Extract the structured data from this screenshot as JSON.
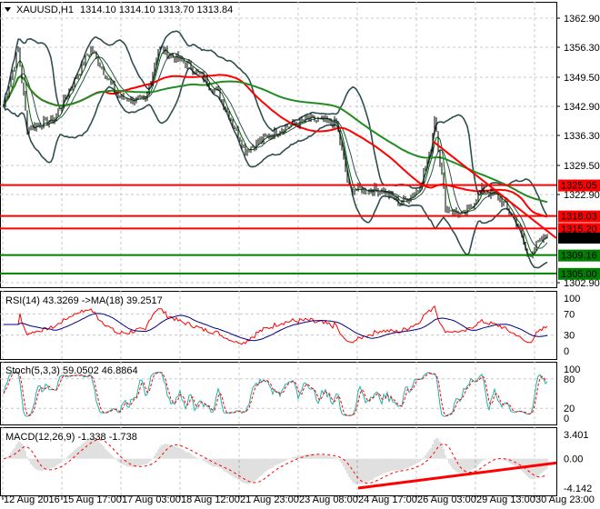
{
  "header": {
    "symbol": "XAUUSD,H1",
    "ohlc": "1314.10 1314.10 1313.70 1313.84"
  },
  "colors": {
    "up": "#000000",
    "line": "#2f4f4f",
    "ma_fast": "#006400",
    "ma_slow": "#006400",
    "ma_mid": "#ff0000",
    "level_red": "#ff0000",
    "level_green": "#008000",
    "rsi": "#ff0000",
    "rsi_ma": "#000080",
    "stoch_main": "#20b2aa",
    "stoch_sig": "#ff0000",
    "macd_hist": "#c0c0c0",
    "macd_sig": "#ff0000"
  },
  "chart_data": [
    {
      "type": "line",
      "title": "XAUUSD,H1",
      "ylim": [
        1302.9,
        1362.9
      ],
      "y_ticks": [
        "1362.90",
        "1356.30",
        "1349.50",
        "1342.90",
        "1336.30",
        "1329.50",
        "1322.90",
        "1302.90"
      ],
      "key_closes": [
        [
          0,
          1343
        ],
        [
          8,
          1356
        ],
        [
          13,
          1338
        ],
        [
          28,
          1340
        ],
        [
          48,
          1356
        ],
        [
          63,
          1345
        ],
        [
          78,
          1344
        ],
        [
          85,
          1356
        ],
        [
          103,
          1352
        ],
        [
          118,
          1346
        ],
        [
          133,
          1333
        ],
        [
          153,
          1338
        ],
        [
          168,
          1340
        ],
        [
          183,
          1339
        ],
        [
          190,
          1324
        ],
        [
          208,
          1324
        ],
        [
          218,
          1321
        ],
        [
          228,
          1324
        ],
        [
          235,
          1333
        ],
        [
          237,
          1341
        ],
        [
          243,
          1320
        ],
        [
          253,
          1318
        ],
        [
          263,
          1324
        ],
        [
          273,
          1322
        ],
        [
          283,
          1316
        ],
        [
          288,
          1309
        ],
        [
          299,
          1313.84
        ]
      ],
      "levels": [
        {
          "label": "1325.05",
          "value": 1325.05,
          "color": "red"
        },
        {
          "label": "1318.03",
          "value": 1318.03,
          "color": "red"
        },
        {
          "label": "1315.20",
          "value": 1315.2,
          "color": "red"
        },
        {
          "label": "1309.16",
          "value": 1309.16,
          "color": "green"
        },
        {
          "label": "1305.00",
          "value": 1305.0,
          "color": "green"
        }
      ],
      "current": {
        "label": "1313.84",
        "value": 1313.84
      },
      "trendline": [
        [
          236,
          1335
        ],
        [
          299,
          1313
        ]
      ]
    },
    {
      "type": "line",
      "title": "RSI(14) 43.3269  ->MA(18) 39.2517",
      "ylim": [
        0,
        100
      ],
      "y_ticks": [
        "100",
        "70",
        "30",
        "0"
      ]
    },
    {
      "type": "line",
      "title": "Stoch(5,3,3) 59.0502 46.8864",
      "ylim": [
        0,
        100
      ],
      "y_ticks": [
        "100",
        "80",
        "20",
        "0"
      ]
    },
    {
      "type": "bar",
      "title": "MACD(12,26,9) -1.338 -1.738",
      "ylim": [
        -4.142,
        3.401
      ],
      "y_ticks": [
        "3.401",
        "0.00",
        "-4.142"
      ],
      "trendline": [
        [
          195,
          -4.142
        ],
        [
          299,
          -0.6
        ]
      ]
    }
  ],
  "x_labels": [
    "12 Aug 2016",
    "15 Aug 17:00",
    "17 Aug 03:00",
    "18 Aug 12:00",
    "21 Aug 23:00",
    "23 Aug 08:00",
    "24 Aug 17:00",
    "26 Aug 03:00",
    "29 Aug 13:00",
    "30 Aug 23:00"
  ]
}
